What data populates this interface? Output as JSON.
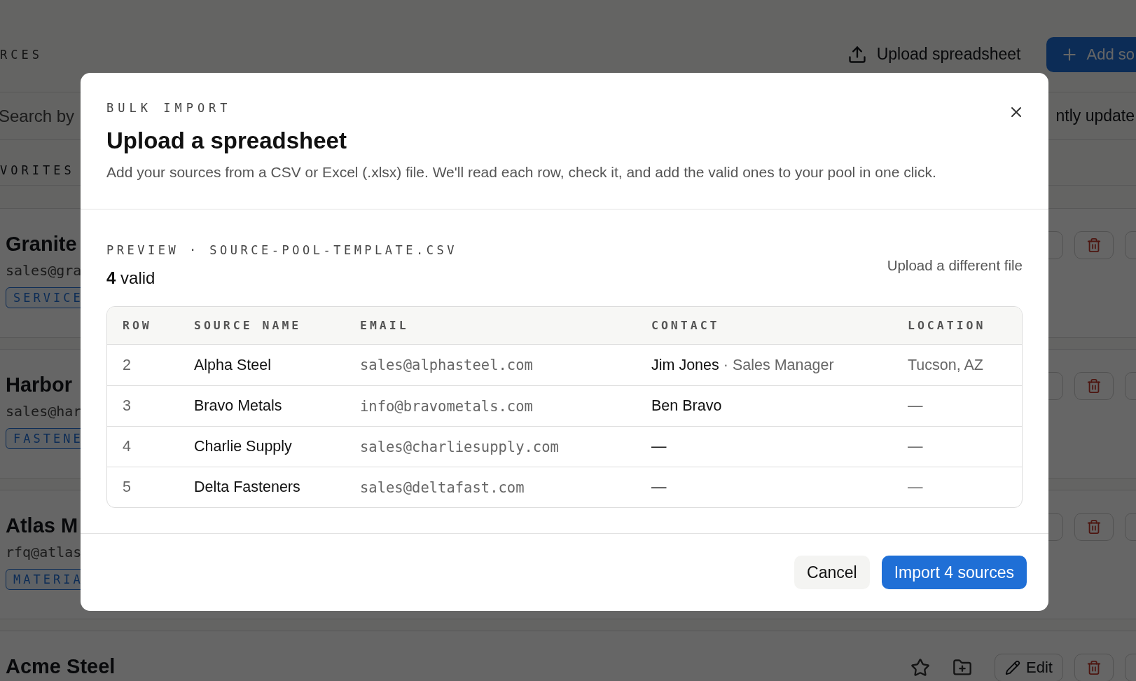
{
  "page": {
    "section_label": "RCES",
    "upload_button": "Upload spreadsheet",
    "add_button": "Add so",
    "search": {
      "placeholder": "Search by"
    },
    "sort": "ntly update",
    "filter_tab": "VORITES",
    "cards": [
      {
        "name": "Granite",
        "email": "sales@gra",
        "tag": "SERVICE"
      },
      {
        "name": "Harbor",
        "email": "sales@har",
        "tag": "FASTENE"
      },
      {
        "name": "Atlas M",
        "email": "rfq@atlas",
        "tag": "MATERIA"
      },
      {
        "name": "Acme Steel",
        "edit": "Edit"
      }
    ]
  },
  "modal": {
    "eyebrow": "BULK IMPORT",
    "title": "Upload a spreadsheet",
    "description": "Add your sources from a CSV or Excel (.xlsx) file. We'll read each row, check it, and add the valid ones to your pool in one click.",
    "preview_label": "PREVIEW · SOURCE-POOL-TEMPLATE.CSV",
    "valid_count": "**4** valid",
    "change_file": "Upload a different file",
    "table": {
      "columns": [
        "ROW",
        "SOURCE NAME",
        "EMAIL",
        "CONTACT",
        "LOCATION"
      ],
      "rows": [
        {
          "row": "2",
          "name": "Alpha Steel",
          "email": "sales@alphasteel.com",
          "contact": {
            "name": "Jim Jones",
            "role": "· Sales Manager"
          },
          "location": "Tucson, AZ"
        },
        {
          "row": "3",
          "name": "Bravo Metals",
          "email": "info@bravometals.com",
          "contact": {
            "name": "Ben Bravo"
          },
          "location": "—"
        },
        {
          "row": "4",
          "name": "Charlie Supply",
          "email": "sales@charliesupply.com",
          "contact": {
            "name": "—"
          },
          "location": "—"
        },
        {
          "row": "5",
          "name": "Delta Fasteners",
          "email": "sales@deltafast.com",
          "contact": {
            "name": "—"
          },
          "location": "—"
        }
      ]
    },
    "buttons": {
      "cancel": "Cancel",
      "confirm": "Import 4 sources"
    }
  }
}
